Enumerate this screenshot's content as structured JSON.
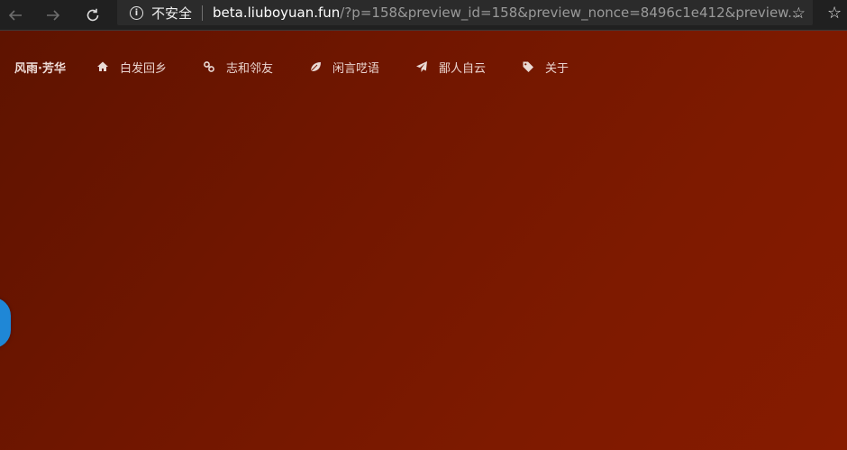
{
  "browser": {
    "security_label": "不安全",
    "url_host": "beta.liuboyuan.fun",
    "url_path": "/?p=158&preview_id=158&preview_nonce=8496c1e412&preview..."
  },
  "site": {
    "brand": "风雨·芳华",
    "menu": [
      {
        "label": "白发回乡",
        "icon": "home-icon"
      },
      {
        "label": "志和邻友",
        "icon": "link-icon"
      },
      {
        "label": "闲言呓语",
        "icon": "leaf-icon"
      },
      {
        "label": "鄙人自云",
        "icon": "paper-plane-icon"
      },
      {
        "label": "关于",
        "icon": "tag-icon"
      }
    ]
  },
  "colors": {
    "page_bg_dark": "#5e1300",
    "page_bg_light": "#861b00",
    "float_button": "#1f87d6"
  }
}
